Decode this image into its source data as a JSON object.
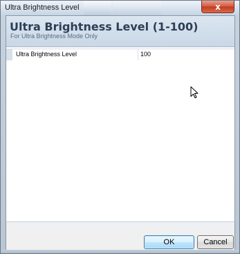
{
  "window": {
    "title": "Ultra Brightness Level",
    "close_symbol": "x"
  },
  "header": {
    "title": "Ultra Brightness Level (1-100)",
    "subtitle": "For Ultra Brightness Mode Only"
  },
  "property_grid": {
    "rows": [
      {
        "name": "Ultra Brightness Level",
        "value": "100"
      }
    ]
  },
  "buttons": {
    "ok_label": "OK",
    "cancel_label": "Cancel"
  },
  "icons": {
    "close": "close-icon",
    "cursor": "mouse-pointer-icon"
  }
}
